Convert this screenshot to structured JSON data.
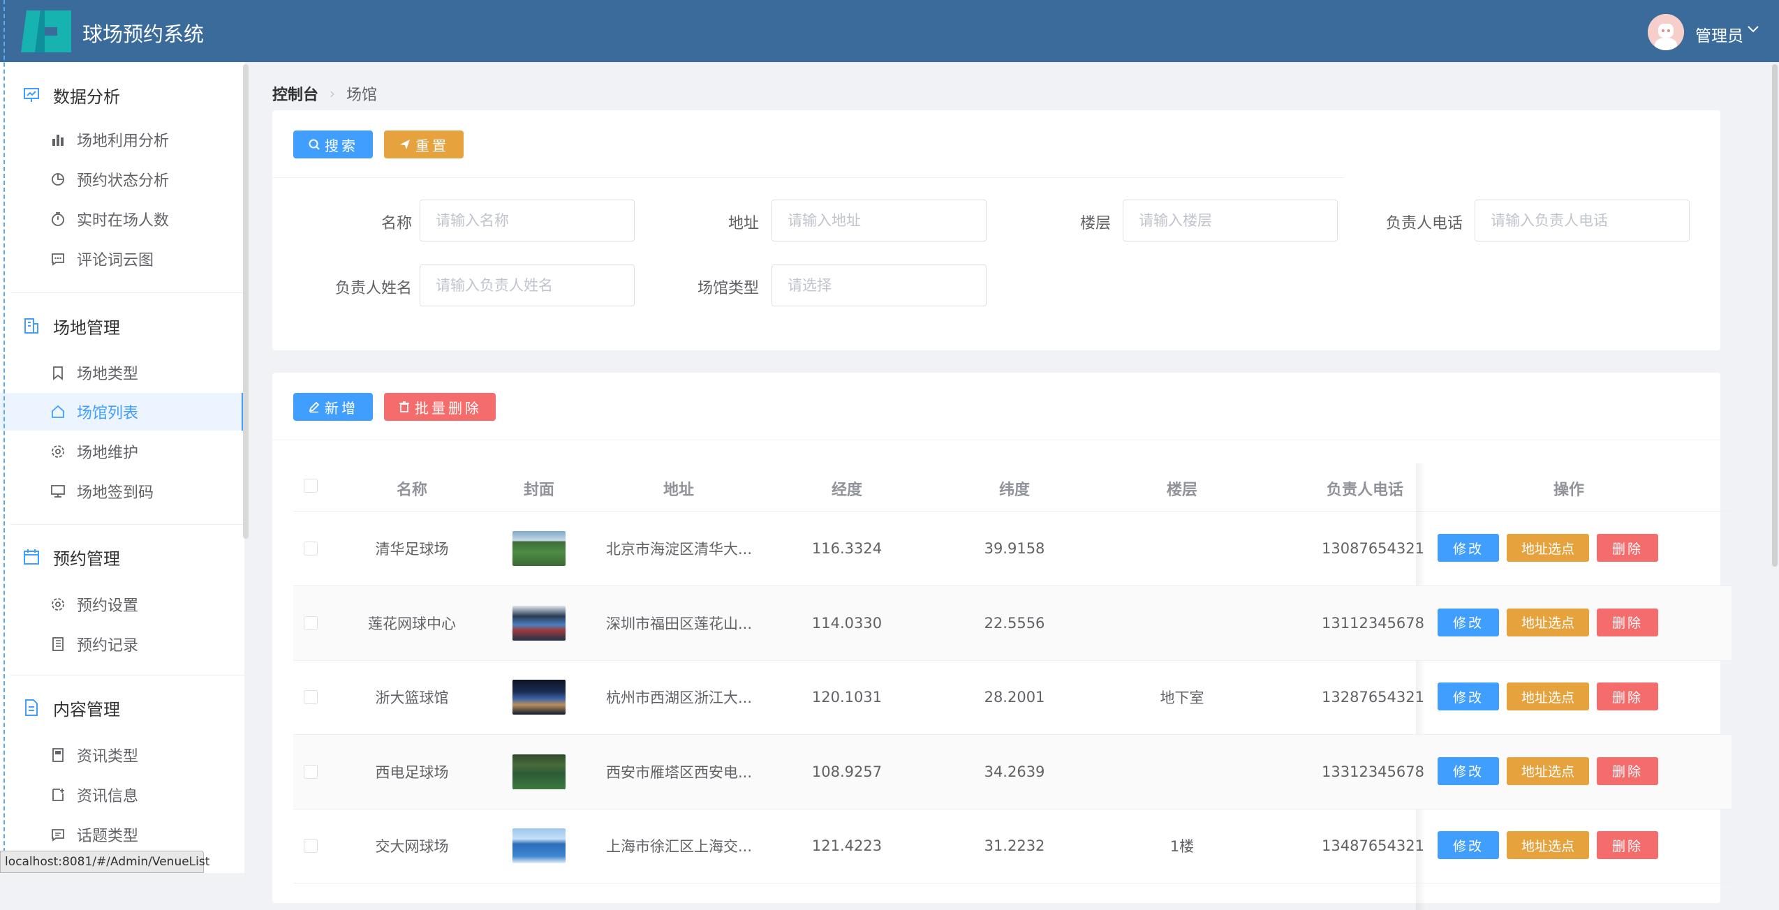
{
  "header": {
    "title": "球场预约系统",
    "user": "管理员",
    "bg_color": "#3a6b9b"
  },
  "sidebar": {
    "groups": [
      {
        "title": "数据分析",
        "items": [
          "场地利用分析",
          "预约状态分析",
          "实时在场人数",
          "评论词云图"
        ]
      },
      {
        "title": "场地管理",
        "items": [
          "场地类型",
          "场馆列表",
          "场地维护",
          "场地签到码"
        ]
      },
      {
        "title": "预约管理",
        "items": [
          "预约设置",
          "预约记录"
        ]
      },
      {
        "title": "内容管理",
        "items": [
          "资讯类型",
          "资讯信息",
          "话题类型"
        ]
      }
    ],
    "active_item": "场馆列表"
  },
  "breadcrumb": {
    "home": "控制台",
    "current": "场馆"
  },
  "search": {
    "search_btn": "搜索",
    "reset_btn": "重置",
    "fields": [
      {
        "label": "名称",
        "placeholder": "请输入名称"
      },
      {
        "label": "地址",
        "placeholder": "请输入地址"
      },
      {
        "label": "楼层",
        "placeholder": "请输入楼层"
      },
      {
        "label": "负责人电话",
        "placeholder": "请输入负责人电话"
      },
      {
        "label": "负责人姓名",
        "placeholder": "请输入负责人姓名"
      },
      {
        "label": "场馆类型",
        "placeholder": "请选择"
      }
    ]
  },
  "actions": {
    "add_btn": "新增",
    "batch_delete_btn": "批量删除"
  },
  "table": {
    "columns": [
      "名称",
      "封面",
      "地址",
      "经度",
      "纬度",
      "楼层",
      "负责人电话",
      "操作"
    ],
    "row_actions": {
      "edit": "修改",
      "locate": "地址选点",
      "delete": "删除"
    },
    "rows": [
      {
        "name": "清华足球场",
        "address": "北京市海淀区清华大...",
        "lng": "116.3324",
        "lat": "39.9158",
        "floor": "",
        "phone": "13087654321",
        "cover": "football-field-photo"
      },
      {
        "name": "莲花网球中心",
        "address": "深圳市福田区莲花山...",
        "lng": "114.0330",
        "lat": "22.5556",
        "floor": "",
        "phone": "13112345678",
        "cover": "tennis-stadium-photo"
      },
      {
        "name": "浙大篮球馆",
        "address": "杭州市西湖区浙江大...",
        "lng": "120.1031",
        "lat": "28.2001",
        "floor": "地下室",
        "phone": "13287654321",
        "cover": "basketball-arena-photo"
      },
      {
        "name": "西电足球场",
        "address": "西安市雁塔区西安电...",
        "lng": "108.9257",
        "lat": "34.2639",
        "floor": "",
        "phone": "13312345678",
        "cover": "football-field-photo-2"
      },
      {
        "name": "交大网球场",
        "address": "上海市徐汇区上海交...",
        "lng": "121.4223",
        "lat": "31.2232",
        "floor": "1楼",
        "phone": "13487654321",
        "cover": "tennis-court-photo"
      }
    ]
  },
  "status_url": "localhost:8081/#/Admin/VenueList",
  "colors": {
    "primary": "#409eff",
    "warning": "#e6a23c",
    "danger": "#f56c6c"
  }
}
